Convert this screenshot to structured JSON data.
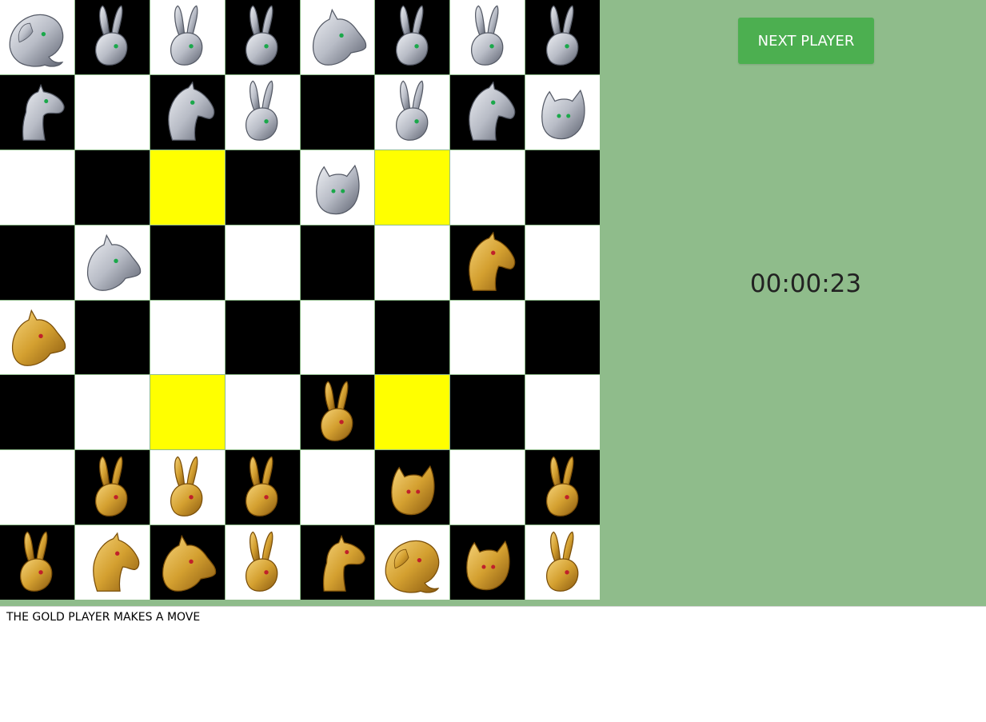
{
  "controls": {
    "next_player_label": "NEXT PLAYER"
  },
  "timer": {
    "value": "00:00:23"
  },
  "status": {
    "message": "THE GOLD PLAYER MAKES A MOVE"
  },
  "colors": {
    "panel_bg": "#8fbc8b",
    "button_bg": "#4caf50",
    "light_square": "#ffffff",
    "dark_square": "#000000",
    "trap_square": "#ffff00",
    "silver_piece": "#b8bcc6",
    "gold_piece": "#d4a030",
    "silver_eye": "#1aa84a",
    "gold_eye": "#c0202a"
  },
  "board": {
    "rows": [
      [
        "silver-elephant",
        "silver-rabbit",
        "silver-rabbit",
        "silver-rabbit",
        "silver-dog",
        "silver-rabbit",
        "silver-rabbit",
        "silver-rabbit"
      ],
      [
        "silver-camel",
        "",
        "silver-horse",
        "silver-rabbit",
        "",
        "silver-rabbit",
        "silver-horse",
        "silver-cat"
      ],
      [
        "",
        "",
        "",
        "",
        "silver-cat",
        "",
        "",
        ""
      ],
      [
        "",
        "silver-dog",
        "",
        "",
        "",
        "",
        "gold-horse",
        ""
      ],
      [
        "gold-dog",
        "",
        "",
        "",
        "",
        "",
        "",
        ""
      ],
      [
        "",
        "",
        "",
        "",
        "gold-rabbit",
        "",
        "",
        ""
      ],
      [
        "",
        "gold-rabbit",
        "gold-rabbit",
        "gold-rabbit",
        "",
        "gold-cat",
        "",
        "gold-rabbit"
      ],
      [
        "gold-rabbit",
        "gold-horse",
        "gold-dog",
        "gold-rabbit",
        "gold-camel",
        "gold-elephant",
        "gold-cat",
        "gold-rabbit"
      ]
    ],
    "traps": [
      [
        2,
        2
      ],
      [
        2,
        5
      ],
      [
        5,
        2
      ],
      [
        5,
        5
      ]
    ]
  }
}
